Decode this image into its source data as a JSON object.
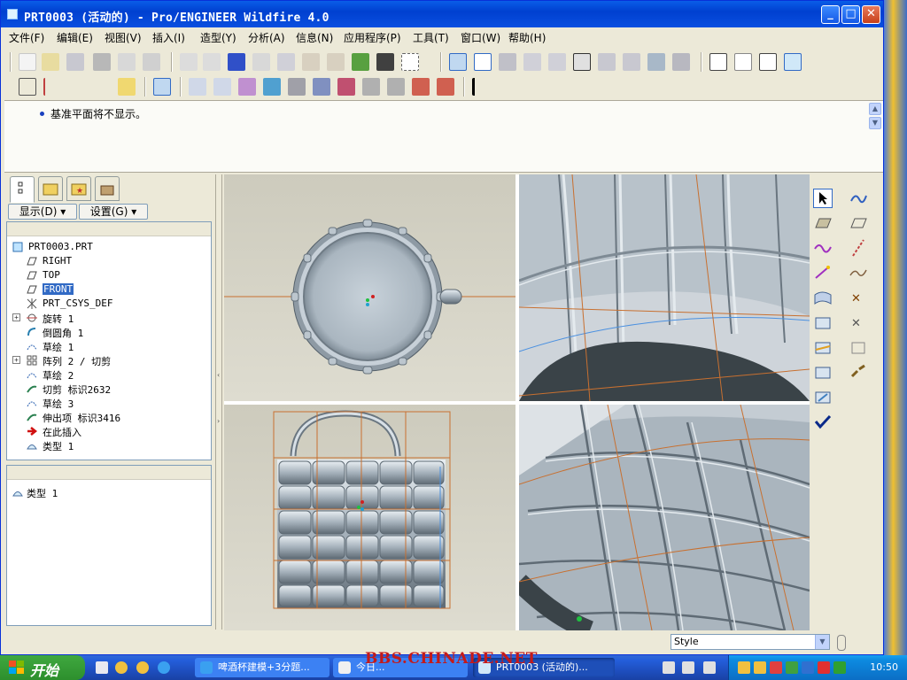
{
  "window": {
    "title": "PRT0003 (活动的) - Pro/ENGINEER Wildfire 4.0",
    "buttons": {
      "minimize": "_",
      "maximize": "□",
      "close": "✕"
    }
  },
  "menu": [
    "文件(F)",
    "编辑(E)",
    "视图(V)",
    "插入(I)",
    "造型(Y)",
    "分析(A)",
    "信息(N)",
    "应用程序(P)",
    "工具(T)",
    "窗口(W)",
    "帮助(H)"
  ],
  "message": {
    "text": "基准平面将不显示。"
  },
  "left_panel": {
    "show_button": "显示(D)",
    "settings_button": "设置(G)",
    "tree": [
      {
        "label": "PRT0003.PRT",
        "icon": "part-icon",
        "expandable": false,
        "selected": false,
        "indent": 0
      },
      {
        "label": "RIGHT",
        "icon": "datum-plane-icon",
        "expandable": false,
        "selected": false,
        "indent": 1
      },
      {
        "label": "TOP",
        "icon": "datum-plane-icon",
        "expandable": false,
        "selected": false,
        "indent": 1
      },
      {
        "label": "FRONT",
        "icon": "datum-plane-icon",
        "expandable": false,
        "selected": true,
        "indent": 1
      },
      {
        "label": "PRT_CSYS_DEF",
        "icon": "csys-icon",
        "expandable": false,
        "selected": false,
        "indent": 1
      },
      {
        "label": "旋转 1",
        "icon": "revolve-icon",
        "expandable": true,
        "selected": false,
        "indent": 1
      },
      {
        "label": "倒圆角 1",
        "icon": "round-icon",
        "expandable": false,
        "selected": false,
        "indent": 1
      },
      {
        "label": "草绘 1",
        "icon": "sketch-icon",
        "expandable": false,
        "selected": false,
        "indent": 1
      },
      {
        "label": "阵列 2 / 切剪",
        "icon": "pattern-icon",
        "expandable": true,
        "selected": false,
        "indent": 1
      },
      {
        "label": "草绘 2",
        "icon": "sketch-icon",
        "expandable": false,
        "selected": false,
        "indent": 1
      },
      {
        "label": "切剪 标识2632",
        "icon": "sweep-cut-icon",
        "expandable": false,
        "selected": false,
        "indent": 1
      },
      {
        "label": "草绘 3",
        "icon": "sketch-icon",
        "expandable": false,
        "selected": false,
        "indent": 1
      },
      {
        "label": "伸出项 标识3416",
        "icon": "sweep-protrusion-icon",
        "expandable": false,
        "selected": false,
        "indent": 1
      },
      {
        "label": "在此插入",
        "icon": "insert-here-arrow-icon",
        "expandable": false,
        "selected": false,
        "indent": 1
      },
      {
        "label": "类型 1",
        "icon": "style-feature-icon",
        "expandable": false,
        "selected": false,
        "indent": 1
      }
    ],
    "lower_tree": [
      {
        "label": "类型 1",
        "icon": "style-feature-icon"
      }
    ]
  },
  "status": {
    "style_value": "Style"
  },
  "taskbar": {
    "start_label": "开始",
    "tasks": [
      {
        "label": "啤酒杯建模+3分题...",
        "icon": "ie-icon"
      },
      {
        "label": "今日...",
        "icon": "browser-icon"
      },
      {
        "label": "PRT0003 (活动的)...",
        "icon": "proe-icon"
      }
    ],
    "clock": "10:50"
  },
  "watermark": "BBS.CHINADE.NET",
  "colors": {
    "title_blue": "#0a5de8",
    "model_gray": "#a9b4bd",
    "datum_orange": "#c87030",
    "axis_blue": "#4a90e0",
    "taskbar_blue": "#245edb"
  }
}
